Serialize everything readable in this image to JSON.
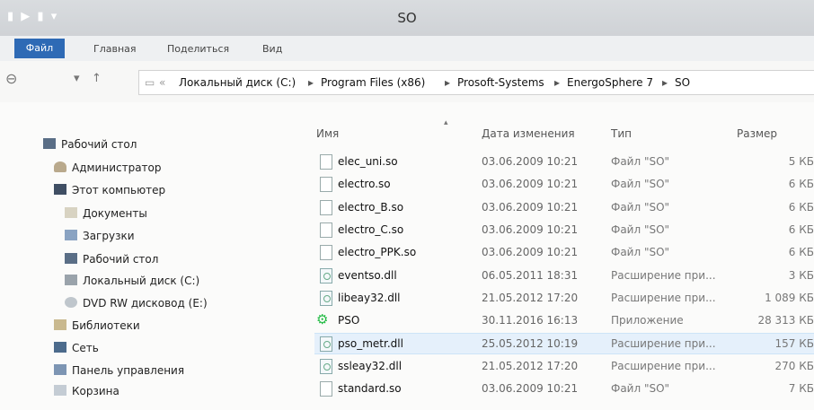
{
  "window": {
    "title": "SO",
    "quick_access": "▮ ▶ ▮ ▾"
  },
  "ribbon": {
    "tabs": [
      "Файл",
      "Главная",
      "Поделиться",
      "Вид"
    ]
  },
  "nav": {
    "back": "⊖",
    "forward": "▾",
    "up": "↑",
    "history": "«"
  },
  "address": {
    "crumbs": [
      "Локальный диск (C:)",
      "Program Files (x86)",
      "Prosoft-Systems",
      "EnergoSphere 7",
      "SO"
    ],
    "sep": "▸"
  },
  "sidebar": {
    "items": [
      {
        "label": "Рабочий стол",
        "icon": "desktop-icon"
      },
      {
        "label": "Администратор",
        "icon": "user-icon"
      },
      {
        "label": "Этот компьютер",
        "icon": "computer-icon"
      },
      {
        "label": "Документы",
        "icon": "documents-icon"
      },
      {
        "label": "Загрузки",
        "icon": "downloads-icon"
      },
      {
        "label": "Рабочий стол",
        "icon": "desktop-icon"
      },
      {
        "label": "Локальный диск (C:)",
        "icon": "drive-icon"
      },
      {
        "label": "DVD RW дисковод (E:)",
        "icon": "dvd-icon"
      },
      {
        "label": "Библиотеки",
        "icon": "library-icon"
      },
      {
        "label": "Сеть",
        "icon": "network-icon"
      },
      {
        "label": "Панель управления",
        "icon": "control-panel-icon"
      },
      {
        "label": "Корзина",
        "icon": "recycle-bin-icon"
      }
    ]
  },
  "columns": {
    "name": "Имя",
    "date": "Дата изменения",
    "type": "Тип",
    "size": "Размер"
  },
  "files": [
    {
      "name": "elec_uni.so",
      "date": "03.06.2009 10:21",
      "type": "Файл \"SO\"",
      "size": "5 КБ",
      "kind": "file"
    },
    {
      "name": "electro.so",
      "date": "03.06.2009 10:21",
      "type": "Файл \"SO\"",
      "size": "6 КБ",
      "kind": "file"
    },
    {
      "name": "electro_B.so",
      "date": "03.06.2009 10:21",
      "type": "Файл \"SO\"",
      "size": "6 КБ",
      "kind": "file"
    },
    {
      "name": "electro_C.so",
      "date": "03.06.2009 10:21",
      "type": "Файл \"SO\"",
      "size": "6 КБ",
      "kind": "file"
    },
    {
      "name": "electro_PPK.so",
      "date": "03.06.2009 10:21",
      "type": "Файл \"SO\"",
      "size": "6 КБ",
      "kind": "file"
    },
    {
      "name": "eventso.dll",
      "date": "06.05.2011 18:31",
      "type": "Расширение при...",
      "size": "3 КБ",
      "kind": "dll"
    },
    {
      "name": "libeay32.dll",
      "date": "21.05.2012 17:20",
      "type": "Расширение при...",
      "size": "1 089 КБ",
      "kind": "dll"
    },
    {
      "name": "PSO",
      "date": "30.11.2016 16:13",
      "type": "Приложение",
      "size": "28 313 КБ",
      "kind": "app"
    },
    {
      "name": "pso_metr.dll",
      "date": "25.05.2012 10:19",
      "type": "Расширение при...",
      "size": "157 КБ",
      "kind": "dll",
      "selected": true
    },
    {
      "name": "ssleay32.dll",
      "date": "21.05.2012 17:20",
      "type": "Расширение при...",
      "size": "270 КБ",
      "kind": "dll"
    },
    {
      "name": "standard.so",
      "date": "03.06.2009 10:21",
      "type": "Файл \"SO\"",
      "size": "7 КБ",
      "kind": "file"
    }
  ]
}
